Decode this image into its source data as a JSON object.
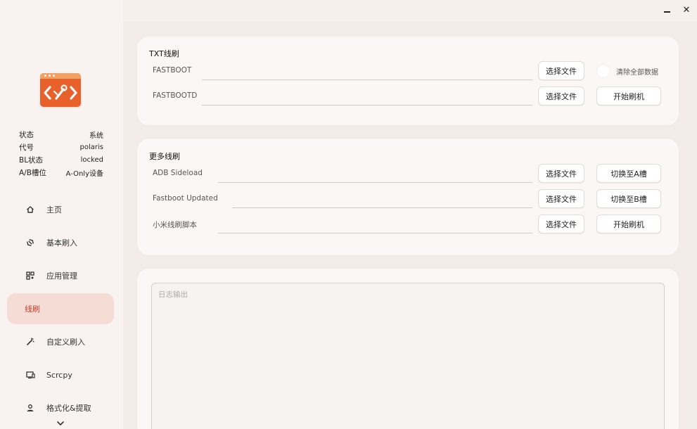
{
  "window": {
    "minimize": "minimize",
    "close": "✕"
  },
  "device": {
    "rows": [
      {
        "label": "状态",
        "value": "系统"
      },
      {
        "label": "代号",
        "value": "polaris"
      },
      {
        "label": "BL状态",
        "value": "locked"
      },
      {
        "label": "A/B槽位",
        "value": "A-Only设备"
      }
    ]
  },
  "nav": {
    "items": [
      {
        "label": "主页",
        "icon": "home-icon"
      },
      {
        "label": "基本刷入",
        "icon": "flash-icon"
      },
      {
        "label": "应用管理",
        "icon": "apps-grid-icon"
      },
      {
        "label": "线刷",
        "icon": "none",
        "active": true
      },
      {
        "label": "自定义刷入",
        "icon": "magic-wand-icon"
      },
      {
        "label": "Scrcpy",
        "icon": "screen-cast-icon"
      },
      {
        "label": "格式化&提取",
        "icon": "user-icon"
      }
    ]
  },
  "txt_flash": {
    "title": "TXT线刷",
    "rows": [
      {
        "label": "FASTBOOT",
        "button": "选择文件"
      },
      {
        "label": "FASTBOOTD",
        "button": "选择文件"
      }
    ],
    "clear_all_label": "清除全部数据",
    "start_button": "开始刷机"
  },
  "more_flash": {
    "title": "更多线刷",
    "rows": [
      {
        "label": "ADB Sideload",
        "button": "选择文件",
        "action": "切换至A槽"
      },
      {
        "label": "Fastboot Updated",
        "button": "选择文件",
        "action": "切换至B槽"
      },
      {
        "label": "小米线刷脚本",
        "button": "选择文件",
        "action": "开始刷机"
      }
    ]
  },
  "log": {
    "placeholder": "日志输出"
  },
  "colors": {
    "accent": "#c83d2a",
    "logo": "#e8602a",
    "active_bg": "#f5dcd5"
  }
}
